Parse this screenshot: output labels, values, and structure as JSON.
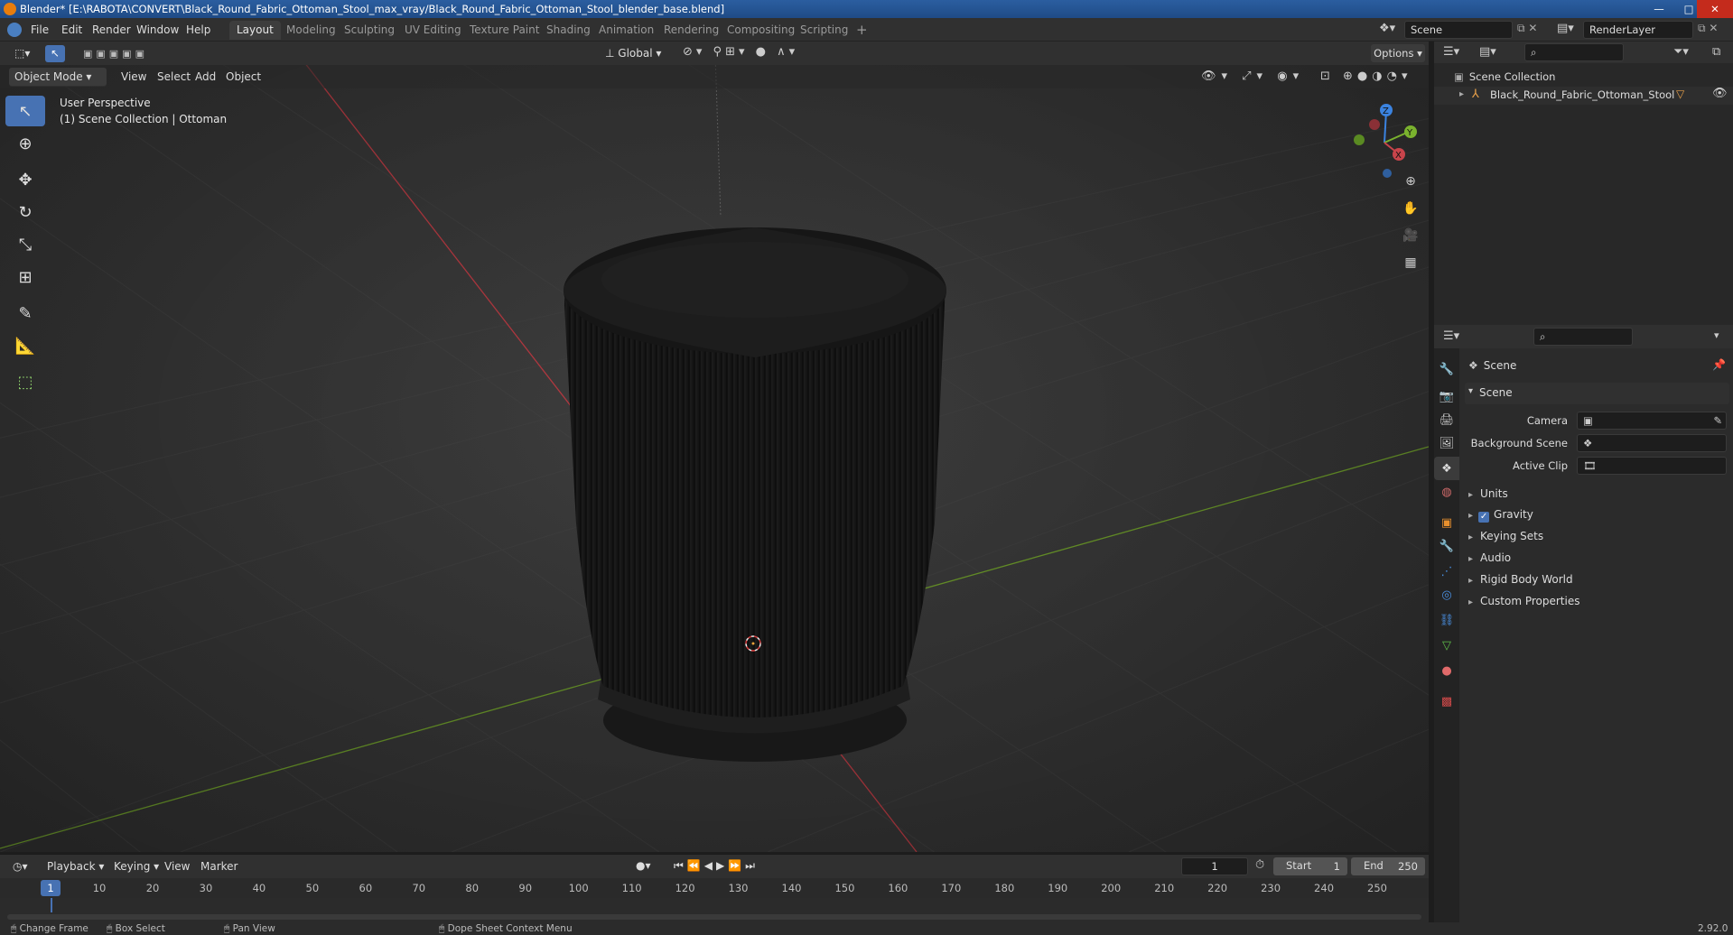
{
  "titlebar": {
    "text": "Blender* [E:\\RABOTA\\CONVERT\\Black_Round_Fabric_Ottoman_Stool_max_vray/Black_Round_Fabric_Ottoman_Stool_blender_base.blend]",
    "minimize": "—",
    "maximize": "□",
    "close": "✕"
  },
  "menubar": {
    "items": [
      "File",
      "Edit",
      "Render",
      "Window",
      "Help"
    ],
    "workspaces": [
      "Layout",
      "Modeling",
      "Sculpting",
      "UV Editing",
      "Texture Paint",
      "Shading",
      "Animation",
      "Rendering",
      "Compositing",
      "Scripting"
    ],
    "add_workspace": "+",
    "scene_name": "Scene",
    "view_layer": "RenderLayer"
  },
  "viewport_header": {
    "mode": "Object Mode",
    "menus": [
      "View",
      "Select",
      "Add",
      "Object"
    ],
    "orientation": "Global",
    "options": "Options"
  },
  "viewport": {
    "perspective": "User Perspective",
    "collection_info": "(1) Scene Collection | Ottoman",
    "axes": {
      "x": "X",
      "y": "Y",
      "z": "Z"
    }
  },
  "outliner": {
    "root": "Scene Collection",
    "object": "Black_Round_Fabric_Ottoman_Stool"
  },
  "properties": {
    "context": "Scene",
    "panel": "Scene",
    "fields": [
      {
        "label": "Camera",
        "value": ""
      },
      {
        "label": "Background Scene",
        "value": ""
      },
      {
        "label": "Active Clip",
        "value": ""
      }
    ],
    "sections": [
      "Units",
      "Gravity",
      "Keying Sets",
      "Audio",
      "Rigid Body World",
      "Custom Properties"
    ]
  },
  "timeline": {
    "menus": [
      "Playback",
      "Keying",
      "View",
      "Marker"
    ],
    "current_frame": "1",
    "start_label": "Start",
    "start": "1",
    "end_label": "End",
    "end": "250",
    "ticks": [
      "1",
      "10",
      "20",
      "30",
      "40",
      "50",
      "60",
      "70",
      "80",
      "90",
      "100",
      "110",
      "120",
      "130",
      "140",
      "150",
      "160",
      "170",
      "180",
      "190",
      "200",
      "210",
      "220",
      "230",
      "240",
      "250"
    ]
  },
  "statusbar": {
    "items": [
      "Change Frame",
      "Box Select",
      "Pan View",
      "Dope Sheet Context Menu"
    ],
    "version": "2.92.0"
  },
  "colors": {
    "accent": "#4772b3",
    "x_axis": "#c8444b",
    "y_axis": "#7ab22e",
    "z_axis": "#3b83e0"
  }
}
